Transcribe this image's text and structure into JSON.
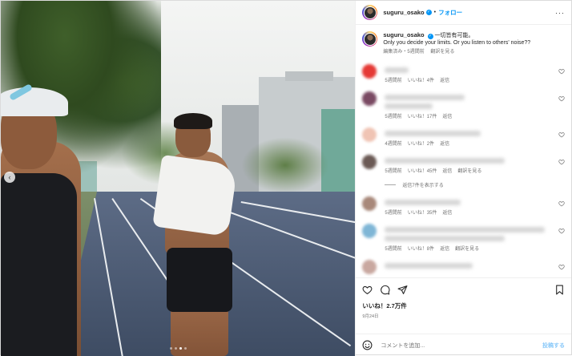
{
  "header": {
    "username": "suguru_osako",
    "separator": "•",
    "follow_label": "フォロー",
    "more_label": "···"
  },
  "caption": {
    "username": "suguru_osako",
    "text_line1": "一切皆有可能。",
    "text_line2": "Only you decide your limits. Or you listen to others' noise??",
    "edited": "編集済み・5週間前",
    "translate": "翻訳を見る"
  },
  "comments": [
    {
      "avatar_color": "#e53935",
      "time": "5週間前",
      "likes": "いいね！4件",
      "reply": "返信",
      "translate": ""
    },
    {
      "avatar_color": "#7a4a63",
      "time": "5週間前",
      "likes": "いいね！17件",
      "reply": "返信",
      "translate": ""
    },
    {
      "avatar_color": "#f0c4b4",
      "time": "4週間前",
      "likes": "いいね！2件",
      "reply": "返信",
      "translate": ""
    },
    {
      "avatar_color": "#6b5a55",
      "time": "5週間前",
      "likes": "いいね！45件",
      "reply": "返信",
      "translate": "翻訳を見る"
    },
    {
      "avatar_color": "#a8887a",
      "time": "5週間前",
      "likes": "いいね！35件",
      "reply": "返信",
      "translate": ""
    },
    {
      "avatar_color": "#7fb6d6",
      "time": "5週間前",
      "likes": "いいね！8件",
      "reply": "返信",
      "translate": "翻訳を見る"
    },
    {
      "avatar_color": "#c9a8a0",
      "time": "",
      "likes": "",
      "reply": "",
      "translate": ""
    }
  ],
  "view_replies": "返信7件を表示する",
  "likes_total": "いいね！2.7万件",
  "post_date": "9月24日",
  "add_comment_placeholder": "コメントを追加...",
  "post_label": "投稿する",
  "carousel": {
    "dots": 4,
    "active_index": 2,
    "prev_label": "‹"
  }
}
